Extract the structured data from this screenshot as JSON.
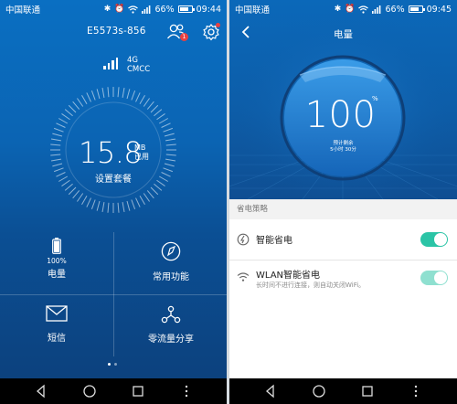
{
  "left_screen": {
    "status": {
      "carrier": "中国联通",
      "battery_pct": "66%",
      "battery_level": 0.66,
      "time": "09:44"
    },
    "header": {
      "device_name": "E5573s-856",
      "user_badge": "1"
    },
    "network": {
      "type": "4G",
      "operator": "CMCC"
    },
    "usage": {
      "value": "15.8",
      "unit_top": "MB",
      "unit_bottom": "已用",
      "plan_label": "设置套餐"
    },
    "grid": [
      {
        "pct": "100%",
        "label": "电量",
        "icon": "battery-icon"
      },
      {
        "label": "常用功能",
        "icon": "compass-icon"
      },
      {
        "label": "短信",
        "icon": "envelope-icon"
      },
      {
        "label": "零流量分享",
        "icon": "share-icon"
      }
    ]
  },
  "right_screen": {
    "status": {
      "carrier": "中国联通",
      "battery_pct": "66%",
      "battery_level": 0.66,
      "time": "09:45"
    },
    "title": "电量",
    "battery": {
      "value": "100",
      "sign": "%",
      "est_label": "预计剩余",
      "est_time": "5小时 30分"
    },
    "section_header": "省电策略",
    "rows": [
      {
        "title": "智能省电",
        "desc": "",
        "icon": "power-save-icon",
        "enabled": true
      },
      {
        "title": "WLAN智能省电",
        "desc": "长时间不进行连接，则自动关闭WiFi。",
        "icon": "wifi-icon",
        "enabled": true
      }
    ]
  },
  "colors": {
    "primary_blue": "#0b64b3",
    "toggle_on": "#2bc4a6",
    "badge_red": "#e94040"
  }
}
